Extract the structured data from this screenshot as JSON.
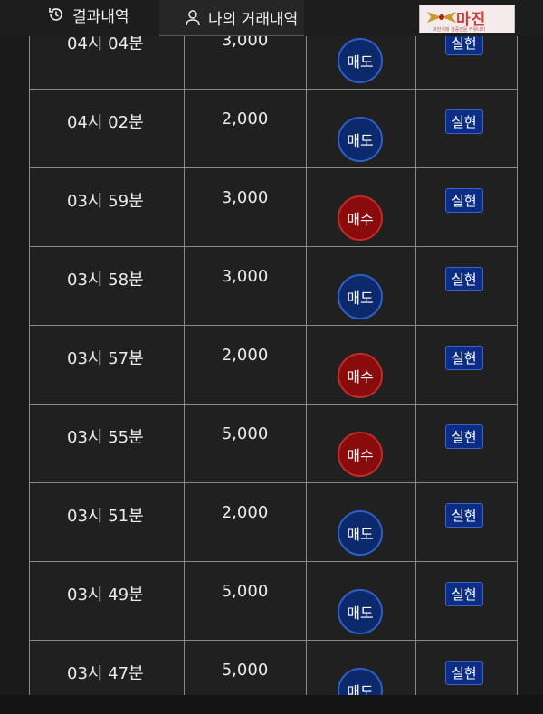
{
  "tabs": {
    "results_label": "결과내역",
    "my_trades_label": "나의 거래내역"
  },
  "logo": {
    "text": "마진",
    "subtext": "마진거래 검증전문 커뮤니티"
  },
  "colors": {
    "sell_badge": "#0c2a6b",
    "buy_badge": "#8a0b0b",
    "real_badge": "#0b2d85"
  },
  "rows": [
    {
      "time": "04시 04분",
      "amount": "3,000",
      "type": "매도",
      "kind": "sell",
      "status": "실현"
    },
    {
      "time": "04시 02분",
      "amount": "2,000",
      "type": "매도",
      "kind": "sell",
      "status": "실현"
    },
    {
      "time": "03시 59분",
      "amount": "3,000",
      "type": "매수",
      "kind": "buy",
      "status": "실현"
    },
    {
      "time": "03시 58분",
      "amount": "3,000",
      "type": "매도",
      "kind": "sell",
      "status": "실현"
    },
    {
      "time": "03시 57분",
      "amount": "2,000",
      "type": "매수",
      "kind": "buy",
      "status": "실현"
    },
    {
      "time": "03시 55분",
      "amount": "5,000",
      "type": "매수",
      "kind": "buy",
      "status": "실현"
    },
    {
      "time": "03시 51분",
      "amount": "2,000",
      "type": "매도",
      "kind": "sell",
      "status": "실현"
    },
    {
      "time": "03시 49분",
      "amount": "5,000",
      "type": "매도",
      "kind": "sell",
      "status": "실현"
    },
    {
      "time": "03시 47분",
      "amount": "5,000",
      "type": "매도",
      "kind": "sell",
      "status": "실현"
    }
  ]
}
